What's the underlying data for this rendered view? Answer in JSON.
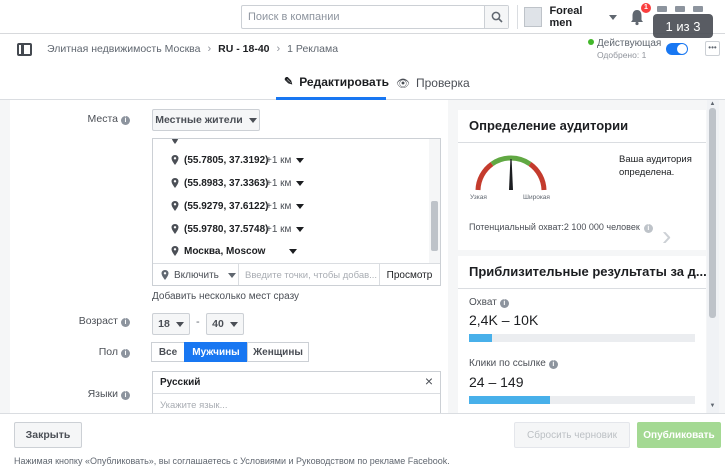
{
  "topbar": {
    "search_placeholder": "Поиск в компании",
    "account_name": "Foreal men",
    "notifications_count": "1",
    "pager": "1 из 3"
  },
  "breadcrumb": {
    "campaign": "Элитная недвижимость Москва",
    "adset": "RU - 18-40",
    "ads": "1 Реклама"
  },
  "status": {
    "label": "Действующая",
    "sub": "Одобрено: 1",
    "toggle_on": true
  },
  "tabs": {
    "edit": "Редактировать",
    "preview": "Проверка"
  },
  "form": {
    "places_label": "Места",
    "places_type": "Местные жители",
    "locations": [
      {
        "coord": "(55.7805, 37.3192)",
        "radius": "+1 км"
      },
      {
        "coord": "(55.8983, 37.3363)",
        "radius": "+1 км"
      },
      {
        "coord": "(55.9279, 37.6122)",
        "radius": "+1 км"
      },
      {
        "coord": "(55.9780, 37.5748)",
        "radius": "+1 км"
      },
      {
        "coord": "Москва, Moscow",
        "radius": ""
      }
    ],
    "include_label": "Включить",
    "location_placeholder": "Введите точки, чтобы добав...",
    "browse": "Просмотр",
    "add_multiple": "Добавить несколько мест сразу",
    "age_label": "Возраст",
    "age_min": "18",
    "age_dash": "-",
    "age_max": "40",
    "gender_label": "Пол",
    "gender_all": "Все",
    "gender_men": "Мужчины",
    "gender_women": "Женщины",
    "languages_label": "Языки",
    "language_selected": "Русский",
    "language_placeholder": "Укажите язык..."
  },
  "audience": {
    "title": "Определение аудитории",
    "gauge_narrow": "Узкая",
    "gauge_wide": "Широкая",
    "description": "Ваша аудитория определена.",
    "potential_reach": "Потенциальный охват:2 100 000 человек"
  },
  "results": {
    "title": "Приблизительные результаты за д...",
    "reach_label": "Охват",
    "reach_value": "2,4K – 10K",
    "reach_fill": 0.1,
    "clicks_label": "Клики по ссылке",
    "clicks_value": "24 – 149",
    "clicks_fill": 0.36
  },
  "footer": {
    "close": "Закрыть",
    "reset": "Сбросить черновик",
    "publish": "Опубликовать",
    "terms": "Нажимая кнопку «Опубликовать», вы соглашаетесь с Условиями и Руководством по рекламе Facebook."
  },
  "colors": {
    "primary": "#1877f2",
    "publish": "#a4d993",
    "bar": "#48b0ea"
  }
}
